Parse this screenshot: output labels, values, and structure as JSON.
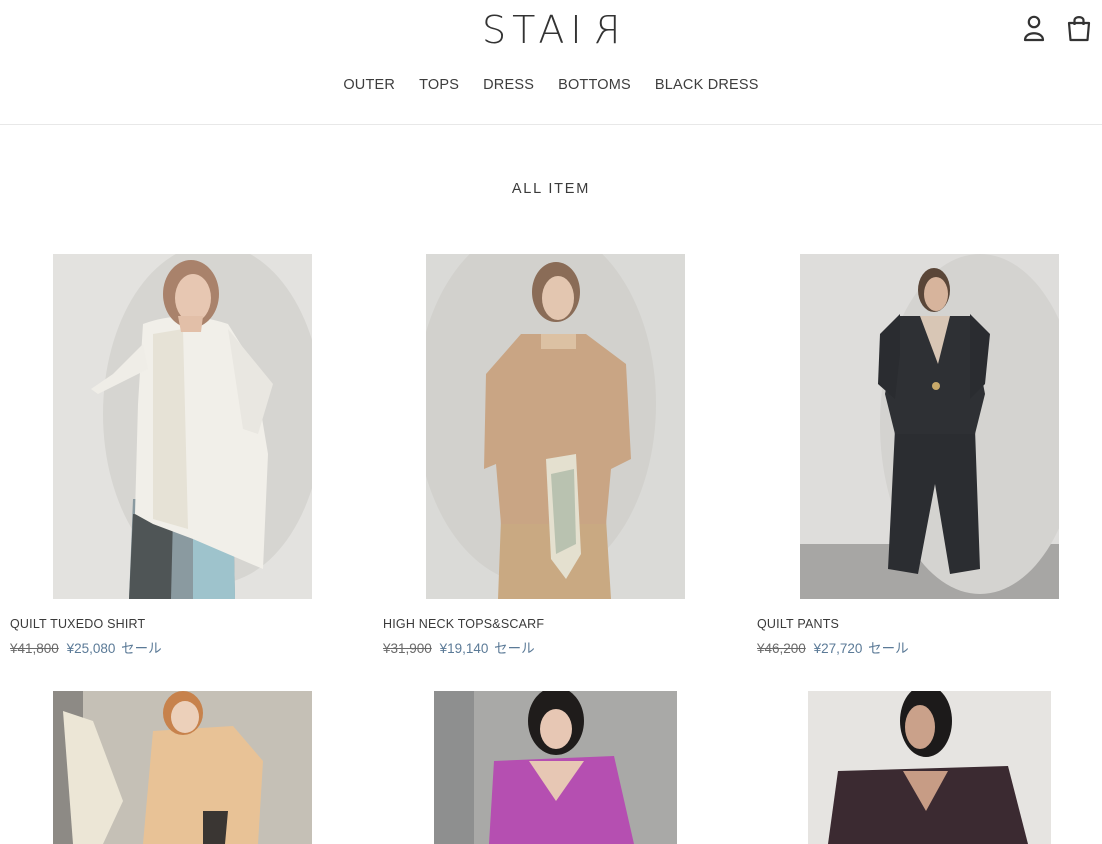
{
  "brand": {
    "logo_left": "STAI",
    "logo_flipped": "R"
  },
  "icons": {
    "account": "account-icon",
    "cart": "cart-icon"
  },
  "nav": {
    "items": [
      "OUTER",
      "TOPS",
      "DRESS",
      "BOTTOMS",
      "BLACK DRESS"
    ]
  },
  "collection": {
    "title": "ALL ITEM"
  },
  "products": [
    {
      "name": "QUILT TUXEDO SHIRT",
      "old_price": "¥41,800",
      "sale_price": "¥25,080",
      "sale_label": "セール"
    },
    {
      "name": "HIGH NECK TOPS&SCARF",
      "old_price": "¥31,900",
      "sale_price": "¥19,140",
      "sale_label": "セール"
    },
    {
      "name": "QUILT PANTS",
      "old_price": "¥46,200",
      "sale_price": "¥27,720",
      "sale_label": "セール"
    },
    {
      "name": "",
      "old_price": "",
      "sale_price": "",
      "sale_label": ""
    },
    {
      "name": "",
      "old_price": "",
      "sale_price": "",
      "sale_label": ""
    },
    {
      "name": "",
      "old_price": "",
      "sale_price": "",
      "sale_label": ""
    }
  ],
  "colors": {
    "sale": "#5b7a97",
    "text": "#3a3a3a"
  }
}
